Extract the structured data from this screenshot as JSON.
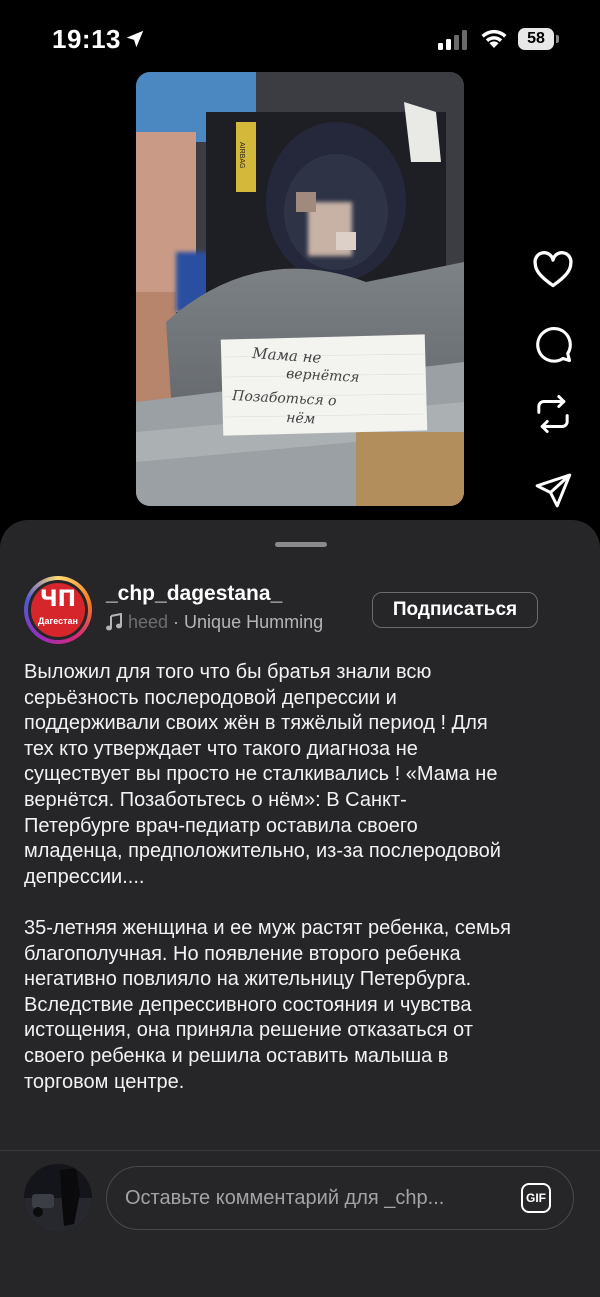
{
  "status_bar": {
    "time": "19:13",
    "battery": "58",
    "icons": [
      "location-arrow-icon",
      "cellular-signal-icon",
      "wifi-icon",
      "battery-icon"
    ]
  },
  "actions": {
    "icons": [
      "heart-icon",
      "comment-icon",
      "repost-icon",
      "send-icon"
    ]
  },
  "post": {
    "avatar_logo": "ЧП",
    "avatar_label": "Дагестан",
    "username": "_chp_dagestana_",
    "audio_faded": "heed",
    "audio_rest": " · Unique Humming",
    "follow_label": "Подписаться",
    "caption_paragraphs": [
      "Выложил для того что бы братья знали всю\nсерьёзность послеродовой депрессии и\nподдерживали своих жён в тяжёлый период ! Для\nтех кто утверждает что такого диагноза не\nсуществует вы просто не сталкивались ! «Мама не\nвернётся. Позаботьтесь о нём»: В Санкт-\nПетербурге врач-педиатр оставила своего\nмладенца, предположительно, из-за послеродовой\nдепрессии....",
      "35-летняя женщина и ее муж растят ребенка, семья\nблагополучная. Но появление второго ребенка\nнегативно повлияло на жительницу Петербурга.\nВследствие депрессивного состояния и чувства\nистощения, она приняла решение отказаться от\nсвоего ребенка и решила оставить малыша в\nторговом центре."
    ]
  },
  "photo": {
    "note_line1": "Мама не",
    "note_line2": "вернётся",
    "note_line3": "Позаботься о",
    "note_line4": "нём",
    "seat_label": "AIRBAG"
  },
  "composer": {
    "placeholder": "Оставьте комментарий для _chp...",
    "gif_label": "GIF"
  }
}
